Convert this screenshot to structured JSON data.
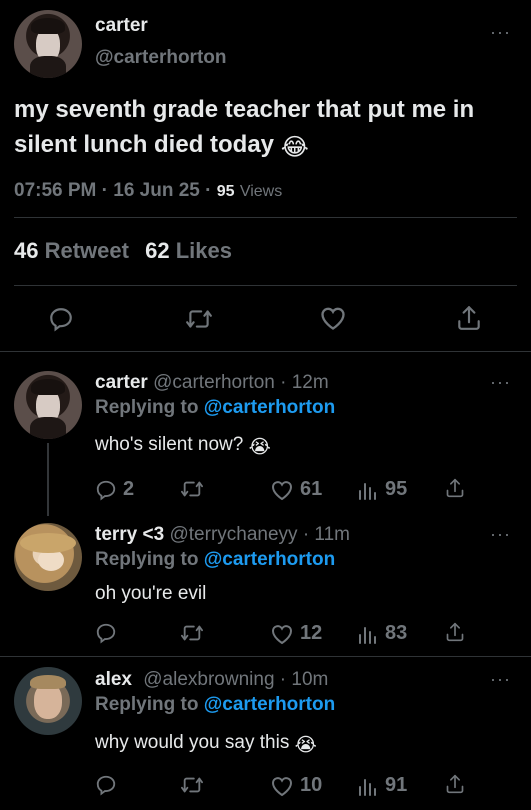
{
  "main_tweet": {
    "name": "carter",
    "handle": "@carterhorton",
    "text": "my seventh grade teacher that put me in silent lunch died today",
    "emoji": "😂",
    "time": "07:56 PM",
    "date": "16 Jun 25",
    "sep1": "·",
    "sep2": "·",
    "views_count": "95",
    "views_label": "Views",
    "retweets_count": "46",
    "retweets_label": "Retweet",
    "likes_count": "62",
    "likes_label": "Likes",
    "more": "···"
  },
  "replies": [
    {
      "name": "carter",
      "handle": "@carterhorton",
      "time": "· 12m",
      "replying_prefix": "Replying to",
      "replying_to": "@carterhorton",
      "text": "who's silent now?",
      "emoji": "😭",
      "comments": "2",
      "retweets": "",
      "likes": "61",
      "views": "95",
      "more": "···"
    },
    {
      "name": "terry <3",
      "handle": "@terrychaneyy",
      "time": "· 11m",
      "replying_prefix": "Replying to",
      "replying_to": "@carterhorton",
      "text": "oh you're evil",
      "emoji": "",
      "comments": "",
      "retweets": "",
      "likes": "12",
      "views": "83",
      "more": "···"
    },
    {
      "name": "alex",
      "handle": "@alexbrowning",
      "time": "· 10m",
      "replying_prefix": "Replying to",
      "replying_to": "@carterhorton",
      "text": "why would you say this",
      "emoji": "😭",
      "comments": "",
      "retweets": "",
      "likes": "10",
      "views": "91",
      "more": "···"
    }
  ],
  "colors": {
    "background": "#000000",
    "text": "#e7e9ea",
    "muted": "#71767b",
    "link": "#1d9bf0",
    "divider": "#2f3336"
  },
  "icons": {
    "reply": "speech-bubble-icon",
    "retweet": "retweet-arrows-icon",
    "like": "heart-icon",
    "views": "bar-chart-icon",
    "share": "share-upload-icon"
  }
}
